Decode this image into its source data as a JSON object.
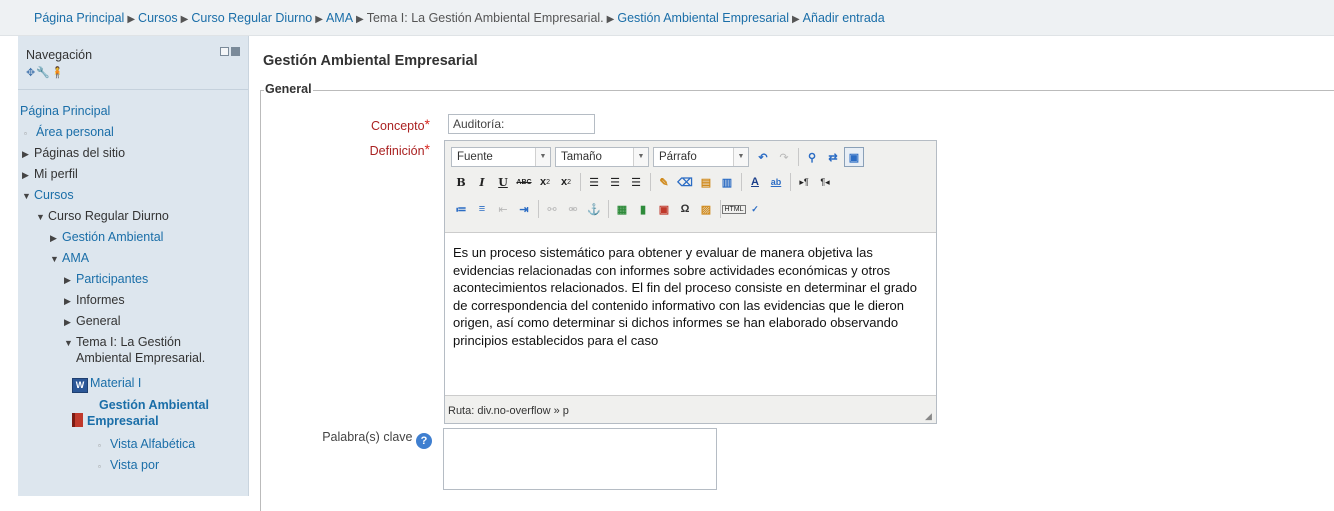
{
  "breadcrumb": [
    {
      "label": "Página Principal",
      "link": true
    },
    {
      "label": "Cursos",
      "link": true
    },
    {
      "label": "Curso Regular Diurno",
      "link": true
    },
    {
      "label": "AMA",
      "link": true
    },
    {
      "label": "Tema I: La Gestión Ambiental Empresarial.",
      "link": false
    },
    {
      "label": "Gestión Ambiental Empresarial",
      "link": true
    },
    {
      "label": "Añadir entrada",
      "link": true
    }
  ],
  "sidebar": {
    "title": "Navegación",
    "tool_icons": "✥🔧🧍",
    "items": [
      {
        "label": "Página Principal"
      },
      {
        "label": "Área personal"
      },
      {
        "label": "Páginas del sitio"
      },
      {
        "label": "Mi perfil"
      },
      {
        "label": "Cursos"
      },
      {
        "label": "Curso Regular Diurno"
      },
      {
        "label": "Gestión Ambiental"
      },
      {
        "label": "AMA"
      },
      {
        "label": "Participantes"
      },
      {
        "label": "Informes"
      },
      {
        "label": "General"
      },
      {
        "label": "Tema I: La Gestión"
      },
      {
        "label": "Ambiental Empresarial."
      },
      {
        "label": "Material I"
      },
      {
        "label": "Gestión Ambiental"
      },
      {
        "label": "Empresarial"
      },
      {
        "label": "Vista Alfabética"
      },
      {
        "label": "Vista por"
      }
    ]
  },
  "main": {
    "heading": "Gestión Ambiental Empresarial",
    "legend": "General",
    "concepto_label": "Concepto",
    "concepto_value": "Auditoría:",
    "definicion_label": "Definición",
    "palabras_label": "Palabra(s) clave",
    "required_mark": "*",
    "help_icon": "?"
  },
  "editor": {
    "font_select": "Fuente",
    "size_select": "Tamaño",
    "format_select": "Párrafo",
    "content": "Es un proceso sistemático para obtener y evaluar de manera objetiva las evidencias relacionadas con informes sobre actividades económicas y otros acontecimientos relacionados. El fin del proceso consiste en determinar el grado de correspondencia del contenido informativo con las evidencias que le dieron origen, así como determinar si dichos informes se han elaborado observando principios establecidos para el caso",
    "path": "Ruta: div.no-overflow » p"
  }
}
